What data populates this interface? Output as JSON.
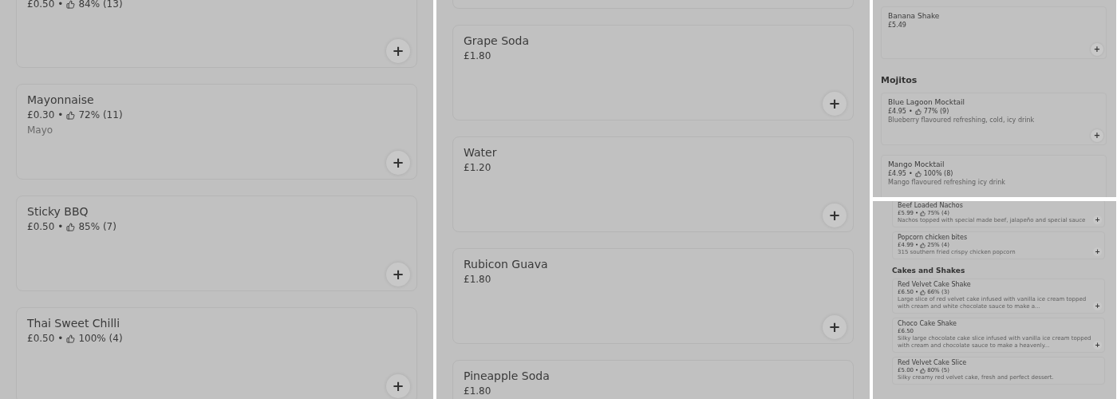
{
  "panels": [
    {
      "sections": [
        {
          "items": [
            {
              "price": "£0.50",
              "separator": "•",
              "rating": "84% (13)",
              "button": "+"
            },
            {
              "name": "Mayonnaise",
              "price": "£0.30",
              "separator": "•",
              "rating": "72% (11)",
              "description": "Mayo",
              "button": "+"
            },
            {
              "name": "Sticky BBQ",
              "price": "£0.50",
              "separator": "•",
              "rating": "85% (7)",
              "button": "+"
            },
            {
              "name": "Thai Sweet Chilli",
              "price": "£0.50",
              "separator": "•",
              "rating": "100% (4)",
              "button": "+"
            }
          ]
        }
      ]
    },
    {
      "sections": [
        {
          "items": [
            {
              "name": "Grape Soda",
              "price": "£1.80",
              "button": "+"
            },
            {
              "name": "Water",
              "price": "£1.20",
              "button": "+"
            },
            {
              "name": "Rubicon Guava",
              "price": "£1.80",
              "button": "+"
            },
            {
              "name": "Pineapple Soda",
              "price": "£1.80"
            }
          ]
        }
      ]
    },
    {
      "sections": [
        {
          "items": [
            {
              "name": "Banana Shake",
              "price": "£5.49",
              "button": "+"
            }
          ]
        },
        {
          "heading": "Mojitos",
          "items": [
            {
              "name": "Blue Lagoon Mocktail",
              "price": "£4.95",
              "separator": "•",
              "rating": "77% (9)",
              "description": "Blueberry flavoured refreshing, cold, icy drink",
              "button": "+"
            },
            {
              "name": "Mango Mocktail",
              "price": "£4.95",
              "separator": "•",
              "rating": "100% (8)",
              "description": "Mango flavoured refreshing icy drink"
            }
          ]
        }
      ]
    },
    {
      "sections": [
        {
          "items": [
            {
              "name": "Beef Loaded Nachos",
              "price": "£5.99",
              "separator": "•",
              "rating": "75% (4)",
              "description": "Nachos topped with special made beef, jalapeño and special sauce",
              "button": "+"
            },
            {
              "name": "Popcorn chicken bites",
              "price": "£4.99",
              "separator": "•",
              "rating": "25% (4)",
              "description": "315 southern fried crispy chicken popcorn",
              "button": "+"
            }
          ]
        },
        {
          "heading": "Cakes and Shakes",
          "items": [
            {
              "name": "Red Velvet Cake Shake",
              "price": "£6.50",
              "separator": "•",
              "rating": "66% (3)",
              "description": "Large slice of red velvet cake infused with vanilla ice cream topped with cream and white chocolate sauce to make a...",
              "button": "+"
            },
            {
              "name": "Choco Cake Shake",
              "price": "£6.50",
              "description": "Silky large chocolate cake slice infused with vanilla ice cream topped with cream and chocolate sauce to make a heavenly...",
              "button": "+"
            },
            {
              "name": "Red Velvet Cake Slice",
              "price": "£5.00",
              "separator": "•",
              "rating": "80% (5)",
              "description": "Silky creamy red velvet cake, fresh and perfect dessert."
            }
          ]
        }
      ]
    }
  ]
}
